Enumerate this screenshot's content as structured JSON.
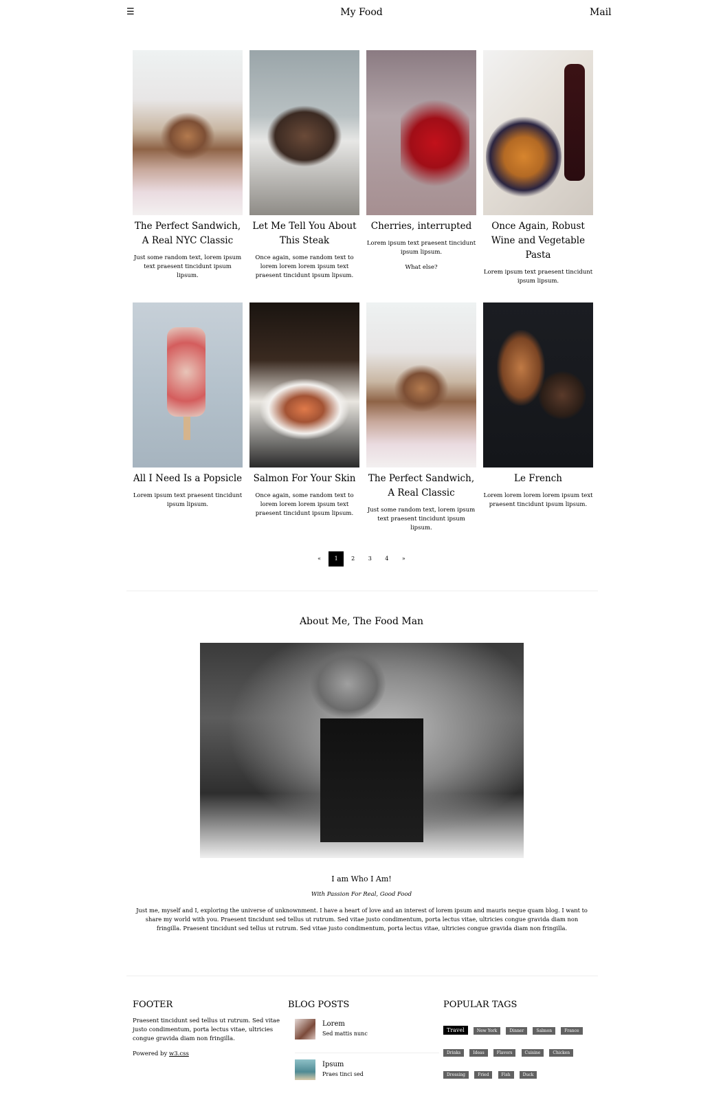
{
  "header": {
    "menu_icon": "☰",
    "title": "My Food",
    "mail_label": "Mail"
  },
  "posts": [
    {
      "title": "The Perfect Sandwich, A Real NYC Classic",
      "text": "Just some random text, lorem ipsum text praesent tincidunt ipsum lipsum.",
      "extra": "",
      "image": "sandwich"
    },
    {
      "title": "Let Me Tell You About This Steak",
      "text": "Once again, some random text to lorem lorem lorem ipsum text praesent tincidunt ipsum lipsum.",
      "extra": "",
      "image": "steak"
    },
    {
      "title": "Cherries, interrupted",
      "text": "Lorem ipsum text praesent tincidunt ipsum lipsum.",
      "extra": "What else?",
      "image": "cherries"
    },
    {
      "title": "Once Again, Robust Wine and Vegetable Pasta",
      "text": "Lorem ipsum text praesent tincidunt ipsum lipsum.",
      "extra": "",
      "image": "pasta"
    },
    {
      "title": "All I Need Is a Popsicle",
      "text": "Lorem ipsum text praesent tincidunt ipsum lipsum.",
      "extra": "",
      "image": "popsicle"
    },
    {
      "title": "Salmon For Your Skin",
      "text": "Once again, some random text to lorem lorem lorem ipsum text praesent tincidunt ipsum lipsum.",
      "extra": "",
      "image": "salmon"
    },
    {
      "title": "The Perfect Sandwich, A Real Classic",
      "text": "Just some random text, lorem ipsum text praesent tincidunt ipsum lipsum.",
      "extra": "",
      "image": "sandwich"
    },
    {
      "title": "Le French",
      "text": "Lorem lorem lorem lorem ipsum text praesent tincidunt ipsum lipsum.",
      "extra": "",
      "image": "french"
    }
  ],
  "pagination": {
    "prev": "«",
    "pages": [
      "1",
      "2",
      "3",
      "4"
    ],
    "active": "1",
    "next": "»"
  },
  "about": {
    "title": "About Me, The Food Man",
    "heading": "I am Who I Am!",
    "subheading": "With Passion For Real, Good Food",
    "text": "Just me, myself and I, exploring the universe of unknownment. I have a heart of love and an interest of lorem ipsum and mauris neque quam blog. I want to share my world with you. Praesent tincidunt sed tellus ut rutrum. Sed vitae justo condimentum, porta lectus vitae, ultricies congue gravida diam non fringilla. Praesent tincidunt sed tellus ut rutrum. Sed vitae justo condimentum, porta lectus vitae, ultricies congue gravida diam non fringilla."
  },
  "footer": {
    "title": "FOOTER",
    "text": "Praesent tincidunt sed tellus ut rutrum. Sed vitae justo condimentum, porta lectus vitae, ultricies congue gravida diam non fringilla.",
    "powered_prefix": "Powered by ",
    "powered_link": "w3.css"
  },
  "blog_posts": {
    "title": "BLOG POSTS",
    "items": [
      {
        "title": "Lorem",
        "subtitle": "Sed mattis nunc"
      },
      {
        "title": "Ipsum",
        "subtitle": "Praes tinci sed"
      }
    ]
  },
  "popular_tags": {
    "title": "POPULAR TAGS",
    "tags": [
      "Travel",
      "New York",
      "Dinner",
      "Salmon",
      "France",
      "Drinks",
      "Ideas",
      "Flavors",
      "Cuisine",
      "Chicken",
      "Dressing",
      "Fried",
      "Fish",
      "Duck"
    ]
  }
}
